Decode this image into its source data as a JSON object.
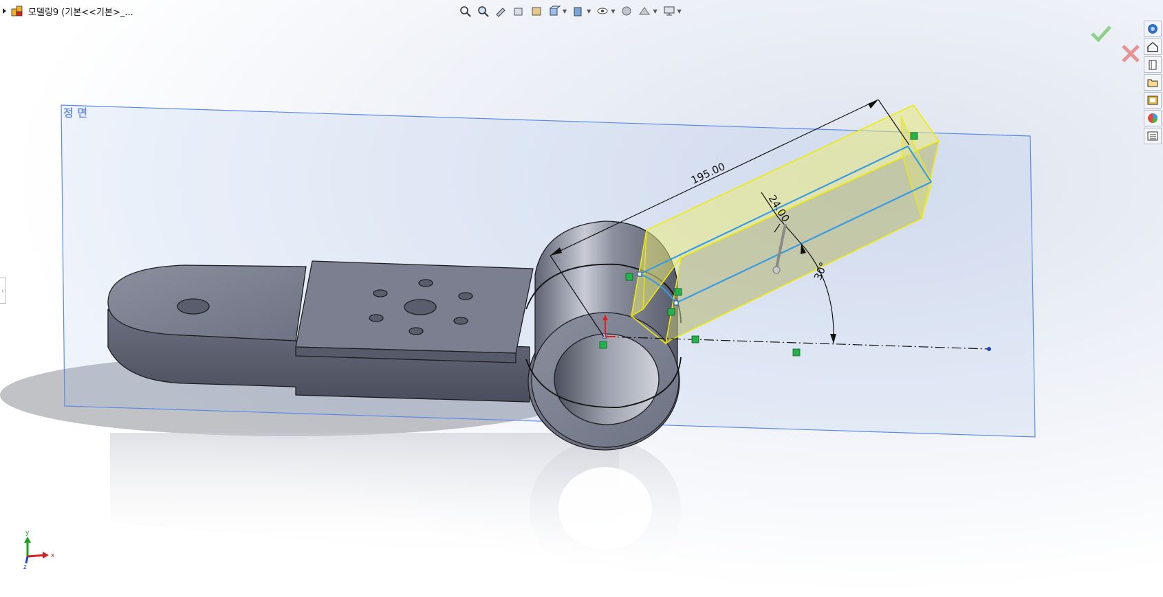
{
  "document": {
    "title": "모델링9  (기본<<기본>_..."
  },
  "toolbar": {
    "icons": [
      "zoom-to-fit-icon",
      "zoom-to-area-icon",
      "previous-view-icon",
      "section-view-icon",
      "dynamic-annotation-icon",
      "view-orientation-icon",
      "display-style-icon",
      "hide-show-items-icon",
      "edit-appearance-icon",
      "apply-scene-icon",
      "view-settings-icon"
    ]
  },
  "confirm": {
    "ok": "✔",
    "cancel": "✖"
  },
  "task_pane": {
    "icons": [
      "solidworks-resources-icon",
      "design-library-icon",
      "file-explorer-icon",
      "view-palette-icon",
      "appearances-icon",
      "custom-properties-icon"
    ]
  },
  "plane": {
    "label": "정 면"
  },
  "dimensions": {
    "length": "195.00",
    "width": "24.00",
    "angle": "30°"
  },
  "triad": {
    "x": "x",
    "y": "y",
    "z": "z"
  },
  "colors": {
    "plane": "#5b8be6",
    "sketch_blue": "#3a9be0",
    "preview_yellow": "#f4f000",
    "relation_green": "#26b24b",
    "part_gray": "#7d8191",
    "ok_green": "#8ed08c",
    "cancel_red": "#e59393"
  }
}
